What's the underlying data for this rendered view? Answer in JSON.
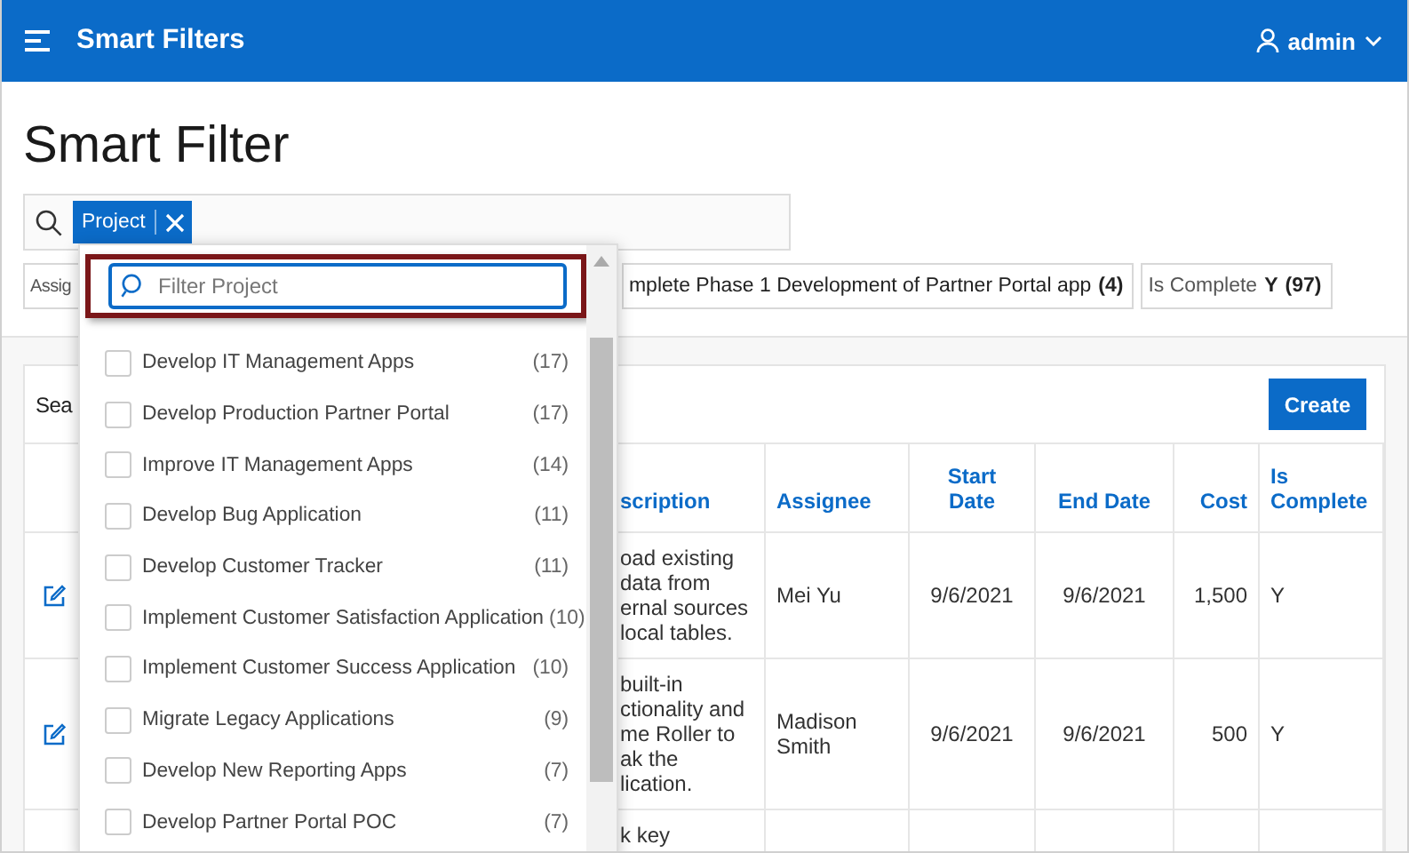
{
  "header": {
    "app_title": "Smart Filters",
    "user": "admin"
  },
  "page_title": "Smart Filter",
  "search": {
    "chips": [
      {
        "label": "Project"
      }
    ]
  },
  "suggestion_chips": [
    {
      "kind": "plain",
      "label": "Assig"
    },
    {
      "kind": "count",
      "label": "mplete Phase 1 Development of Partner Portal app",
      "count": "(4)"
    },
    {
      "kind": "value",
      "label": "Is Complete",
      "value": "Y",
      "count": "(97)"
    }
  ],
  "dropdown": {
    "placeholder": "Filter Project",
    "options": [
      {
        "label": "Develop IT Management Apps",
        "count": "(17)",
        "checked": false
      },
      {
        "label": "Develop Production Partner Portal",
        "count": "(17)",
        "checked": false
      },
      {
        "label": "Improve IT Management Apps",
        "count": "(14)",
        "checked": false
      },
      {
        "label": "Develop Bug Application",
        "count": "(11)",
        "checked": false
      },
      {
        "label": "Develop Customer Tracker",
        "count": "(11)",
        "checked": false
      },
      {
        "label": "Implement Customer Satisfaction Application",
        "count": "(10)",
        "checked": false
      },
      {
        "label": "Implement Customer Success Application",
        "count": "(10)",
        "checked": false
      },
      {
        "label": "Migrate Legacy Applications",
        "count": "(9)",
        "checked": false
      },
      {
        "label": "Develop New Reporting Apps",
        "count": "(7)",
        "checked": false
      },
      {
        "label": "Develop Partner Portal POC",
        "count": "(7)",
        "checked": false
      }
    ]
  },
  "region": {
    "title": "Sea",
    "create_button": "Create"
  },
  "table": {
    "columns": [
      {
        "label": "scription"
      },
      {
        "label": "Assignee"
      },
      {
        "label": "Start Date"
      },
      {
        "label": "End Date"
      },
      {
        "label": "Cost"
      },
      {
        "label": "Is Complete"
      }
    ],
    "rows": [
      {
        "kind": "record",
        "cells": [
          "oad existing\ndata from\nernal sources\nlocal tables.",
          "Mei Yu",
          "9/6/2021",
          "9/6/2021",
          "1,500",
          "Y"
        ]
      },
      {
        "kind": "record",
        "cells": [
          "built-in\nctionality and\nme Roller to\nak the\nlication.",
          "Madison\nSmith",
          "9/6/2021",
          "9/6/2021",
          "500",
          "Y"
        ]
      },
      {
        "kind": "partial",
        "cells": [
          "k key",
          "",
          "",
          "",
          "",
          ""
        ]
      }
    ]
  }
}
